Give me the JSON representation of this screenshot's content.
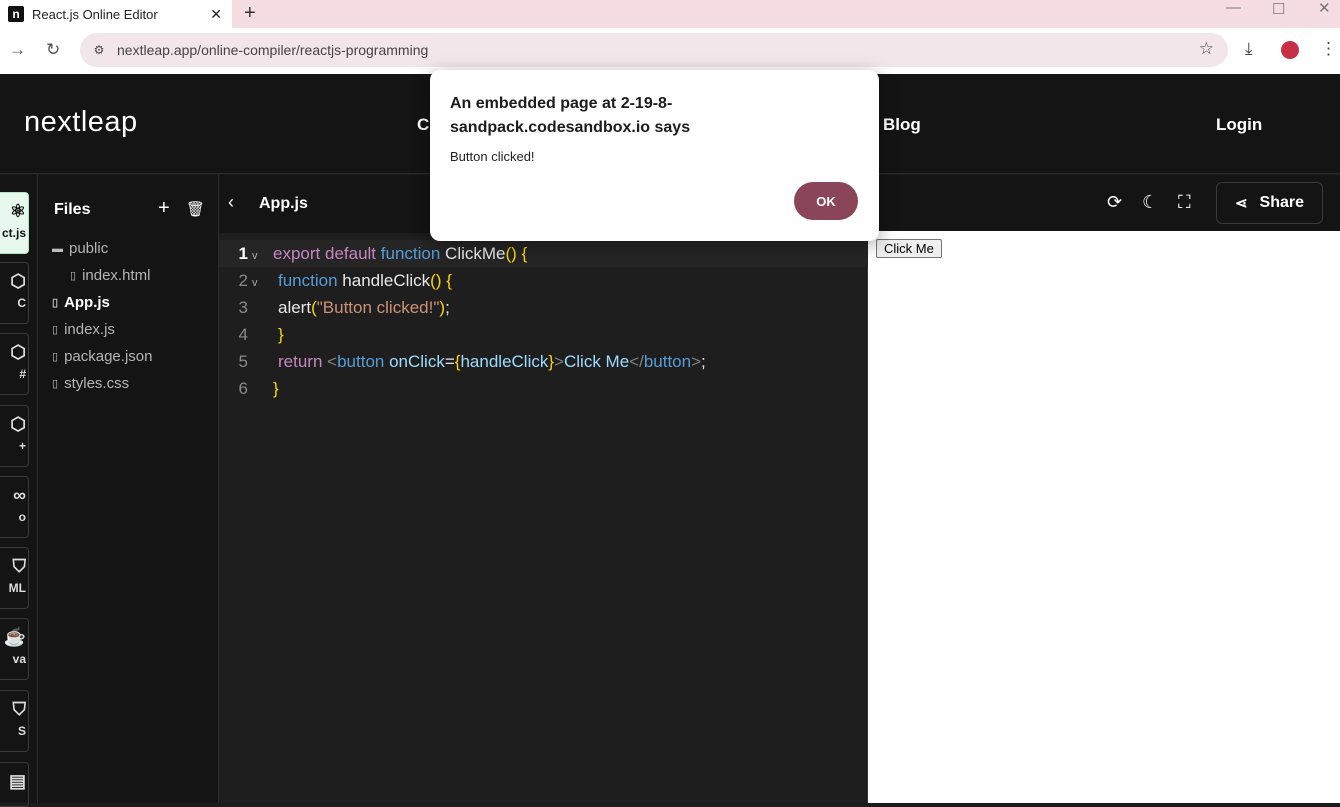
{
  "browser": {
    "tab_title": "React.js Online Editor",
    "favicon_letter": "n",
    "url": "nextleap.app/online-compiler/reactjs-programming"
  },
  "site": {
    "logo": "nextleap",
    "nav_partial": "C",
    "nav_blog": "Blog",
    "nav_login": "Login"
  },
  "rail": {
    "items": [
      {
        "label": "ct.js",
        "icon": "react-icon"
      },
      {
        "label": "C",
        "icon": "c-icon"
      },
      {
        "label": "#",
        "icon": "csharp-icon"
      },
      {
        "label": "+",
        "icon": "cpp-icon"
      },
      {
        "label": "o",
        "icon": "go-icon"
      },
      {
        "label": "ML",
        "icon": "html-icon"
      },
      {
        "label": "va",
        "icon": "java-icon"
      },
      {
        "label": "S",
        "icon": "css-icon"
      },
      {
        "label": "",
        "icon": "file-icon"
      }
    ]
  },
  "files": {
    "title": "Files",
    "items": [
      {
        "name": "public",
        "type": "folder"
      },
      {
        "name": "index.html",
        "type": "file"
      },
      {
        "name": "App.js",
        "type": "file"
      },
      {
        "name": "index.js",
        "type": "file"
      },
      {
        "name": "package.json",
        "type": "file"
      },
      {
        "name": "styles.css",
        "type": "file"
      }
    ]
  },
  "editor": {
    "filename": "App.js",
    "line_numbers": [
      "1",
      "2",
      "3",
      "4",
      "5",
      "6"
    ],
    "code": {
      "l1_kw1": "export",
      "l1_kw2": "default",
      "l1_kw3": "function",
      "l1_name": "ClickMe",
      "l1_paren": "()",
      "l1_brace": "{",
      "l2_kw": "function",
      "l2_name": "handleClick",
      "l2_paren": "()",
      "l2_brace": "{",
      "l3_fn": "alert",
      "l3_p1": "(",
      "l3_str": "\"Button clicked!\"",
      "l3_p2": ")",
      "l3_semi": ";",
      "l4_brace": "}",
      "l5_kw": "return",
      "l5_lt": "<",
      "l5_tag": "button",
      "l5_attr": "onClick",
      "l5_eq": "=",
      "l5_b1": "{",
      "l5_ref": "handleClick",
      "l5_b2": "}",
      "l5_gt": ">",
      "l5_text": "Click Me",
      "l5_close_lt": "</",
      "l5_close_tag": "button",
      "l5_close_gt": ">",
      "l5_semi": ";",
      "l6_brace": "}"
    }
  },
  "preview": {
    "share_label": "Share",
    "button_label": "Click Me"
  },
  "dialog": {
    "title": "An embedded page at 2-19-8-sandpack.codesandbox.io says",
    "message": "Button clicked!",
    "ok_label": "OK"
  }
}
